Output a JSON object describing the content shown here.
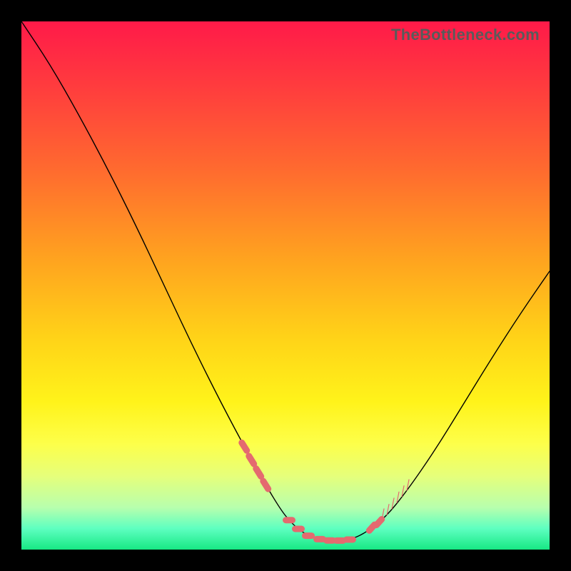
{
  "watermark": "TheBottleneck.com",
  "chart_data": {
    "type": "line",
    "title": "",
    "xlabel": "",
    "ylabel": "",
    "xlim": [
      0,
      740
    ],
    "ylim": [
      0,
      740
    ],
    "series": [
      {
        "name": "bottleneck-curve",
        "x": [
          0,
          40,
          80,
          120,
          160,
          200,
          240,
          280,
          320,
          360,
          380,
          400,
          420,
          440,
          460,
          480,
          510,
          540,
          580,
          620,
          660,
          700,
          740
        ],
        "y": [
          0,
          60,
          130,
          205,
          285,
          370,
          455,
          535,
          610,
          680,
          705,
          720,
          726,
          728,
          726,
          718,
          695,
          658,
          600,
          535,
          470,
          408,
          350
        ]
      }
    ],
    "markers": {
      "left_cluster": [
        310,
        320,
        330,
        340
      ],
      "bottom_blobs": [
        375,
        388,
        402,
        418,
        432,
        446,
        460
      ],
      "right_ticks": [
        505,
        512,
        519,
        526,
        533,
        540
      ],
      "right_cluster": [
        488,
        498
      ]
    }
  }
}
